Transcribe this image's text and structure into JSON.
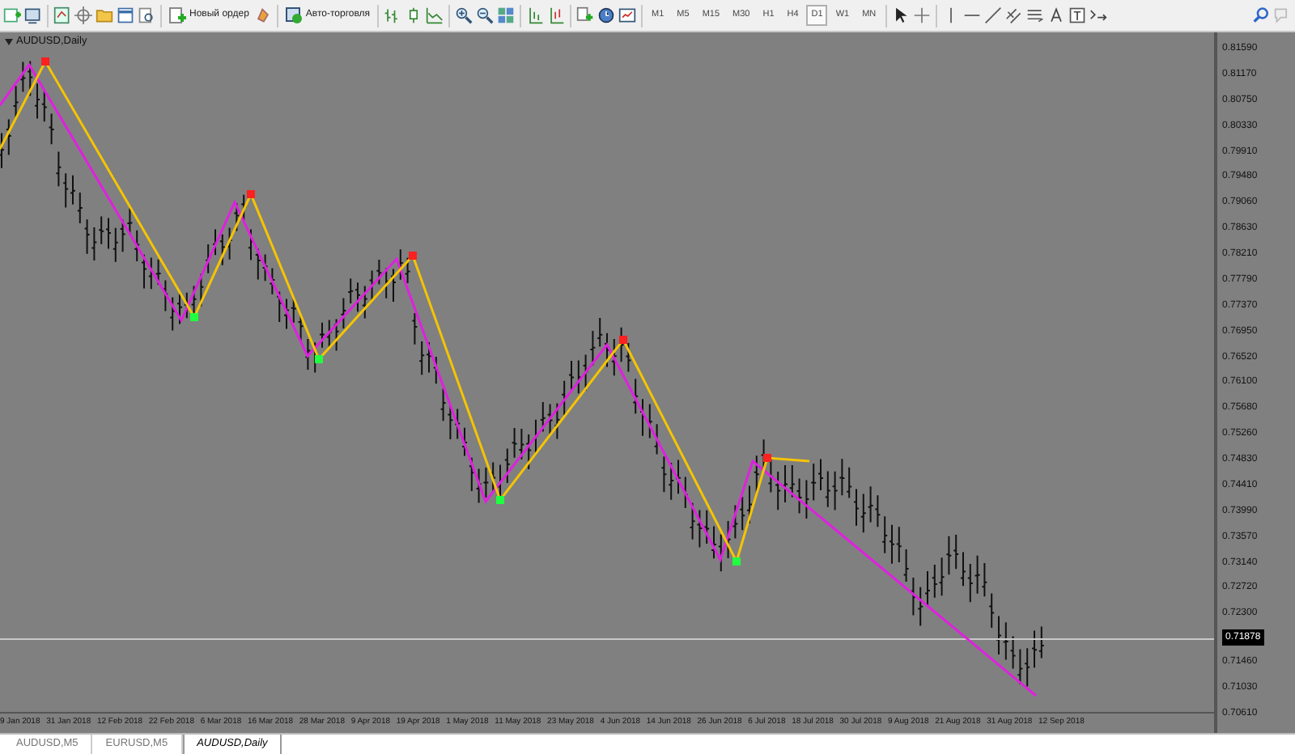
{
  "toolbar": {
    "order_button": "Новый ордер",
    "autotrade_button": "Авто-торговля",
    "timeframes": [
      {
        "label": "M1",
        "selected": false
      },
      {
        "label": "M5",
        "selected": false
      },
      {
        "label": "M15",
        "selected": false
      },
      {
        "label": "M30",
        "selected": false
      },
      {
        "label": "H1",
        "selected": false
      },
      {
        "label": "H4",
        "selected": false
      },
      {
        "label": "D1",
        "selected": true
      },
      {
        "label": "W1",
        "selected": false
      },
      {
        "label": "MN",
        "selected": false
      }
    ]
  },
  "chart": {
    "title": "AUDUSD,Daily",
    "price_axis": [
      {
        "text": "0.81590",
        "kind": "tick"
      },
      {
        "text": "0.81170",
        "kind": "tick"
      },
      {
        "text": "0.80750",
        "kind": "tick"
      },
      {
        "text": "0.80330",
        "kind": "tick"
      },
      {
        "text": "0.79910",
        "kind": "tick"
      },
      {
        "text": "0.79480",
        "kind": "tick"
      },
      {
        "text": "0.79060",
        "kind": "tick"
      },
      {
        "text": "0.78630",
        "kind": "tick"
      },
      {
        "text": "0.78210",
        "kind": "tick"
      },
      {
        "text": "0.77790",
        "kind": "tick"
      },
      {
        "text": "0.77370",
        "kind": "tick"
      },
      {
        "text": "0.76950",
        "kind": "tick"
      },
      {
        "text": "0.76520",
        "kind": "tick"
      },
      {
        "text": "0.76100",
        "kind": "tick"
      },
      {
        "text": "0.75680",
        "kind": "tick"
      },
      {
        "text": "0.75260",
        "kind": "tick"
      },
      {
        "text": "0.74830",
        "kind": "tick"
      },
      {
        "text": "0.74410",
        "kind": "tick"
      },
      {
        "text": "0.73990",
        "kind": "tick"
      },
      {
        "text": "0.73570",
        "kind": "tick"
      },
      {
        "text": "0.73140",
        "kind": "tick"
      },
      {
        "text": "0.72720",
        "kind": "tick"
      },
      {
        "text": "0.72300",
        "kind": "tick"
      },
      {
        "text": "0.71878",
        "kind": "current"
      },
      {
        "text": "0.71460",
        "kind": "tick"
      },
      {
        "text": "0.71030",
        "kind": "tick"
      },
      {
        "text": "0.70610",
        "kind": "tick"
      }
    ],
    "time_axis": [
      "9 Jan 2018",
      "31 Jan 2018",
      "12 Feb 2018",
      "22 Feb 2018",
      "6 Mar 2018",
      "16 Mar 2018",
      "28 Mar 2018",
      "9 Apr 2018",
      "19 Apr 2018",
      "1 May 2018",
      "11 May 2018",
      "23 May 2018",
      "4 Jun 2018",
      "14 Jun 2018",
      "26 Jun 2018",
      "6 Jul 2018",
      "18 Jul 2018",
      "30 Jul 2018",
      "9 Aug 2018",
      "21 Aug 2018",
      "31 Aug 2018",
      "12 Sep 2018"
    ]
  },
  "tabs": [
    {
      "label": "AUDUSD,M5",
      "selected": false
    },
    {
      "label": "EURUSD,M5",
      "selected": false
    },
    {
      "label": "AUDUSD,Daily",
      "selected": true
    }
  ]
}
